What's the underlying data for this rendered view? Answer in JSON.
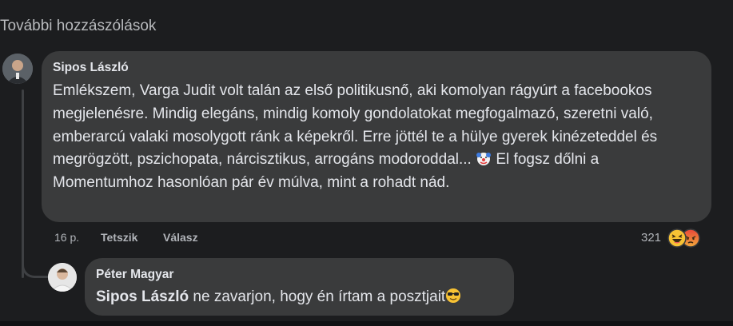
{
  "header": {
    "more_comments_label": "További hozzászólások"
  },
  "comment": {
    "author": "Sipos László",
    "text_part1": "Emlékszem, Varga Judit volt talán az első politikusnő, aki komolyan rágyúrt a facebookos megjelenésre. Mindig elegáns, mindig komoly gondolatokat megfogalmazó, szeretni való, emberarcú valaki mosolygott ránk a képekről. Erre jöttél te a hülye gyerek kinézeteddel és megrögzött, pszichopata, nárcisztikus, arrogáns modoroddal...",
    "inline_emoji": "clown-face-icon",
    "text_part2": " El fogsz dőlni a Momentumhoz hasonlóan pár év múlva, mint a rohadt nád.",
    "time": "16 p.",
    "like_label": "Tetszik",
    "reply_label": "Válasz",
    "reaction_count": "321",
    "reaction_icons": [
      "haha-reaction-icon",
      "angry-reaction-icon"
    ]
  },
  "reply": {
    "author": "Péter Magyar",
    "mention": "Sipos László",
    "text": " ne zavarjon, hogy én írtam a posztjait",
    "trailing_emoji": "sunglasses-face-icon"
  },
  "colors": {
    "background": "#1c1d1f",
    "bubble": "#3a3b3c",
    "text_primary": "#e4e6eb",
    "text_secondary": "#b0b3b8",
    "haha_yellow": "#f7c234",
    "angry_red": "#e9463a"
  }
}
